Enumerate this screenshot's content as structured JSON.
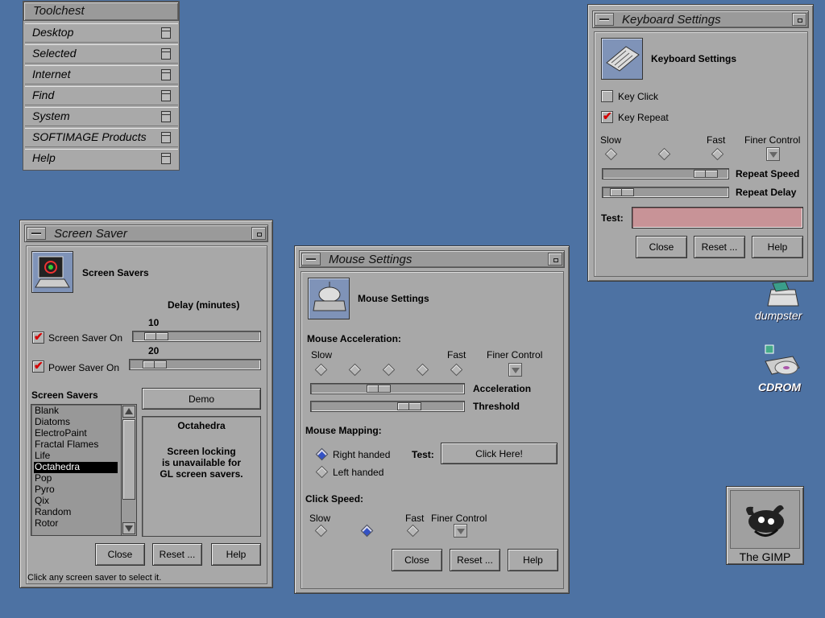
{
  "toolchest": {
    "title": "Toolchest",
    "items": [
      "Desktop",
      "Selected",
      "Internet",
      "Find",
      "System",
      "SOFTIMAGE Products",
      "Help"
    ]
  },
  "screensaver": {
    "title": "Screen Saver",
    "header": "Screen Savers",
    "delay_label": "Delay (minutes)",
    "screen_saver_on": "Screen Saver On",
    "screen_saver_value": "10",
    "power_saver_on": "Power Saver On",
    "power_saver_value": "20",
    "list_label": "Screen Savers",
    "demo": "Demo",
    "items": [
      "Blank",
      "Diatoms",
      "ElectroPaint",
      "Fractal Flames",
      "Life",
      "Octahedra",
      "Pop",
      "Pyro",
      "Qix",
      "Random",
      "Rotor"
    ],
    "selected": "Octahedra",
    "preview_title": "Octahedra",
    "preview_msg_1": "Screen locking",
    "preview_msg_2": "is unavailable for",
    "preview_msg_3": "GL screen savers.",
    "close": "Close",
    "reset": "Reset ...",
    "help": "Help",
    "status": "Click any screen saver to select it."
  },
  "mouse": {
    "title": "Mouse Settings",
    "header": "Mouse Settings",
    "accel_label": "Mouse Acceleration:",
    "slow": "Slow",
    "fast": "Fast",
    "finer": "Finer Control",
    "acceleration": "Acceleration",
    "threshold": "Threshold",
    "mapping_label": "Mouse Mapping:",
    "right": "Right handed",
    "left": "Left handed",
    "test": "Test:",
    "click_here": "Click Here!",
    "click_speed": "Click Speed:",
    "slow2": "Slow",
    "fast2": "Fast",
    "finer2": "Finer Control",
    "close": "Close",
    "reset": "Reset ...",
    "help": "Help"
  },
  "keyboard": {
    "title": "Keyboard Settings",
    "header": "Keyboard Settings",
    "key_click": "Key Click",
    "key_repeat": "Key Repeat",
    "slow": "Slow",
    "fast": "Fast",
    "finer": "Finer Control",
    "repeat_speed": "Repeat Speed",
    "repeat_delay": "Repeat Delay",
    "test": "Test:",
    "close": "Close",
    "reset": "Reset ...",
    "help": "Help"
  },
  "desktop": {
    "dumpster": "dumpster",
    "cdrom": "CDROM",
    "gimp": "The GIMP"
  },
  "colors": {
    "desktop": "#4d72a3",
    "window": "#aaaaaa",
    "test_field": "#c89397"
  }
}
